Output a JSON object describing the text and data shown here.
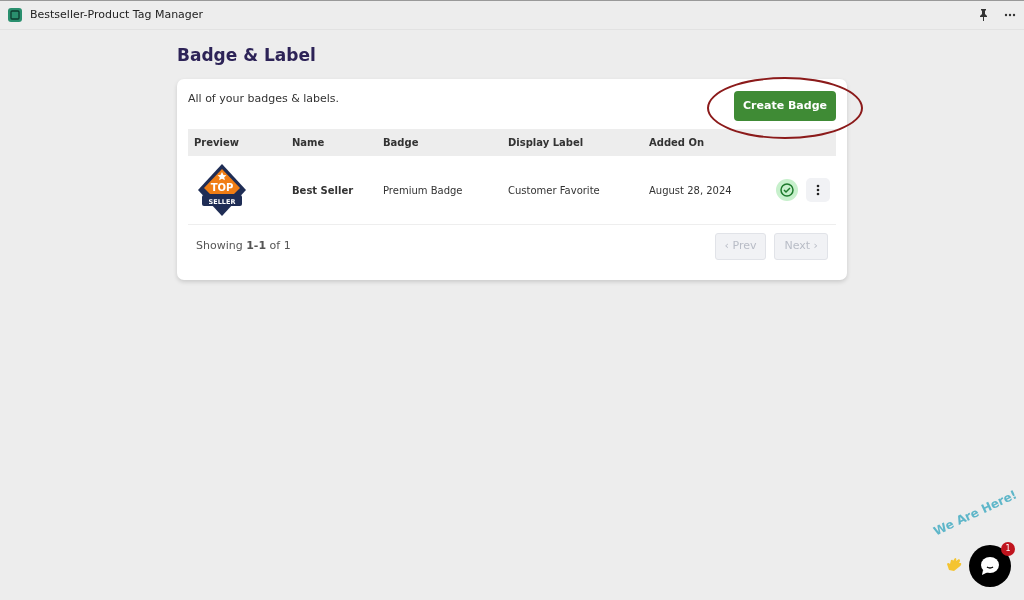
{
  "window": {
    "title": "Bestseller-Product Tag Manager"
  },
  "page": {
    "title": "Badge & Label"
  },
  "card": {
    "description": "All of your badges & labels.",
    "create_button": "Create Badge",
    "create_highlighted": true
  },
  "table": {
    "columns": [
      "Preview",
      "Name",
      "Badge",
      "Display Label",
      "Added On"
    ],
    "rows": [
      {
        "preview": {
          "top": "TOP",
          "bottom": "SELLER"
        },
        "name": "Best Seller",
        "badge": "Premium Badge",
        "display_label": "Customer Favorite",
        "added_on": "August 28, 2024",
        "active": true
      }
    ]
  },
  "pagination": {
    "summary": "Showing **1-1** of 1",
    "prev": {
      "label": "‹ Prev",
      "disabled": true
    },
    "next": {
      "label": "Next ›",
      "disabled": true
    }
  },
  "chat_widget": {
    "caption": "We Are Here!",
    "badge": "1"
  }
}
